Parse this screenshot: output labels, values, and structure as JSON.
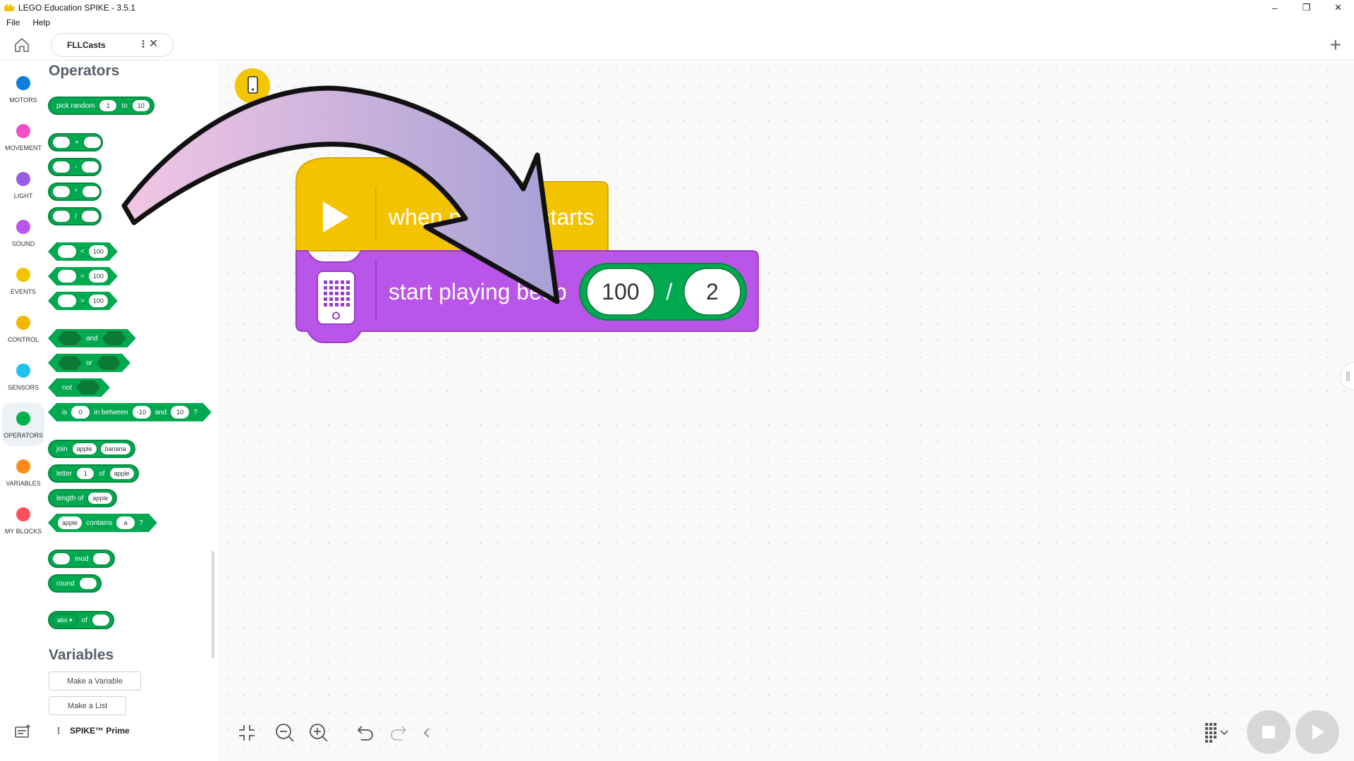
{
  "window": {
    "title": "LEGO Education SPIKE - 3.5.1"
  },
  "menu": [
    "File",
    "Help"
  ],
  "tab": {
    "name": "FLLCasts"
  },
  "categories": [
    {
      "label": "MOTORS",
      "color": "#0b7ee0"
    },
    {
      "label": "MOVEMENT",
      "color": "#f04fc8"
    },
    {
      "label": "LIGHT",
      "color": "#9a5be4"
    },
    {
      "label": "SOUND",
      "color": "#b955e8"
    },
    {
      "label": "EVENTS",
      "color": "#f3c300"
    },
    {
      "label": "CONTROL",
      "color": "#f5b800"
    },
    {
      "label": "SENSORS",
      "color": "#1ec2f0"
    },
    {
      "label": "OPERATORS",
      "color": "#00b04f"
    },
    {
      "label": "VARIABLES",
      "color": "#ff8c1a"
    },
    {
      "label": "MY BLOCKS",
      "color": "#ff4f5e"
    }
  ],
  "palette": {
    "heading": "Operators",
    "pick_random": {
      "label": "pick random",
      "from": "1",
      "to_label": "to",
      "to": "10"
    },
    "math_ops": [
      "+",
      "-",
      "*",
      "/"
    ],
    "compare": [
      {
        "op": "<",
        "value": "100"
      },
      {
        "op": "=",
        "value": "100"
      },
      {
        "op": ">",
        "value": "100"
      }
    ],
    "and_label": "and",
    "or_label": "or",
    "not_label": "not",
    "between": {
      "is": "is",
      "value": "0",
      "label": "in between",
      "low": "-10",
      "and": "and",
      "high": "10",
      "q": "?"
    },
    "join": {
      "label": "join",
      "a": "apple",
      "b": "banana"
    },
    "letter": {
      "label": "letter",
      "index": "1",
      "of": "of",
      "word": "apple"
    },
    "length": {
      "label": "length of",
      "word": "apple"
    },
    "contains": {
      "word": "apple",
      "label": "contains",
      "letter": "a",
      "q": "?"
    },
    "mod_label": "mod",
    "round_label": "round",
    "abs": {
      "label": "abs ▾",
      "of": "of"
    },
    "variables_heading": "Variables",
    "make_variable": "Make a Variable",
    "make_list": "Make a List"
  },
  "hub": {
    "label": "SPIKE™ Prime"
  },
  "script": {
    "hat": "when program starts",
    "stack_block": "start playing beep",
    "operand_a": "100",
    "operator": "/",
    "operand_b": "2"
  },
  "colors": {
    "operators": "#00a84f",
    "events": "#f3c300",
    "sound": "#b955e8"
  }
}
